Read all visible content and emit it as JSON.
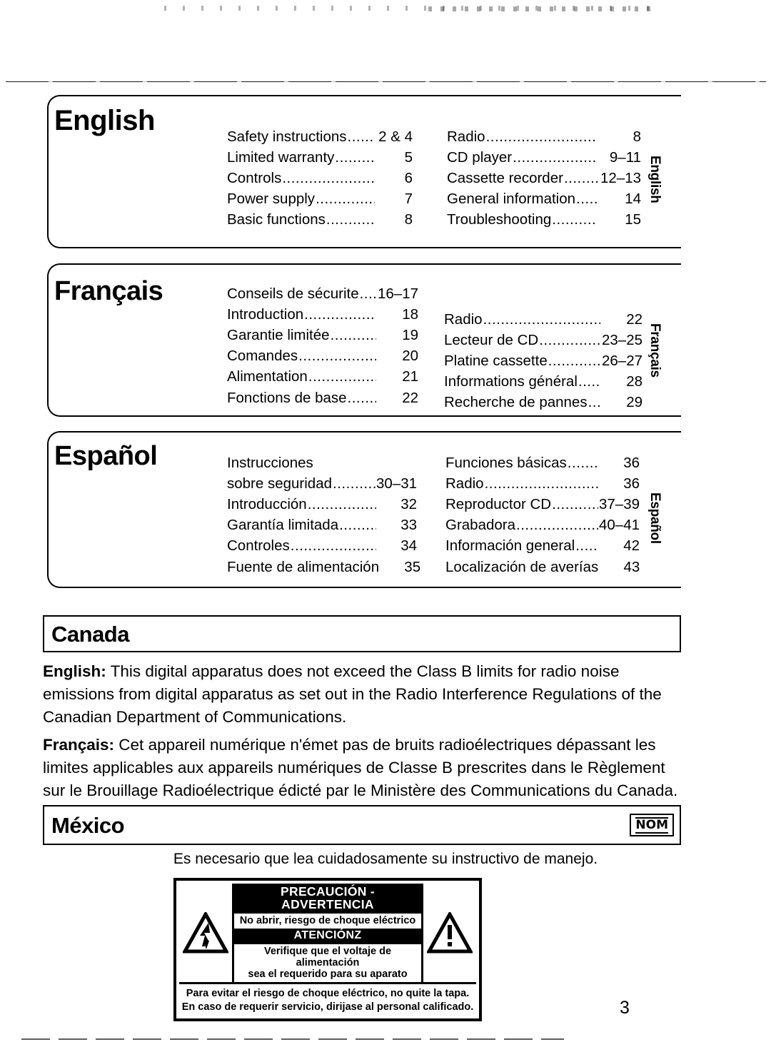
{
  "page": {
    "number": "3"
  },
  "sections": [
    {
      "id": "english",
      "title": "English",
      "side_tab": "English",
      "columns": [
        [
          {
            "label": "Safety instructions",
            "page": "2 & 4"
          },
          {
            "label": "Limited warranty",
            "page": "5"
          },
          {
            "label": "Controls",
            "page": "6"
          },
          {
            "label": "Power supply",
            "page": "7"
          },
          {
            "label": "Basic functions",
            "page": "8"
          }
        ],
        [
          {
            "label": "Radio",
            "page": "8"
          },
          {
            "label": "CD player",
            "page": "9–11"
          },
          {
            "label": "Cassette recorder",
            "page": "12–13"
          },
          {
            "label": "General information",
            "page": "14"
          },
          {
            "label": "Troubleshooting",
            "page": "15"
          }
        ]
      ]
    },
    {
      "id": "francais",
      "title": "Français",
      "side_tab": "Français",
      "columns": [
        [
          {
            "label": "Conseils de sécurite",
            "page": "16–17"
          },
          {
            "label": "Introduction",
            "page": "18"
          },
          {
            "label": "Garantie limitée",
            "page": "19"
          },
          {
            "label": "Comandes",
            "page": "20"
          },
          {
            "label": "Alimentation",
            "page": "21"
          },
          {
            "label": "Fonctions de base",
            "page": "22"
          }
        ],
        [
          {
            "label": "Radio",
            "page": "22"
          },
          {
            "label": "Lecteur de CD",
            "page": "23–25"
          },
          {
            "label": "Platine cassette",
            "page": "26–27"
          },
          {
            "label": "Informations général",
            "page": "28"
          },
          {
            "label": "Recherche de pannes",
            "page": "29"
          }
        ]
      ]
    },
    {
      "id": "espanol",
      "title": "Español",
      "side_tab": "Español",
      "columns": [
        [
          {
            "label": "Instrucciones",
            "page": "",
            "nodots": true
          },
          {
            "label": "sobre seguridad",
            "page": "30–31"
          },
          {
            "label": "Introducción",
            "page": "32"
          },
          {
            "label": "Garantía limitada",
            "page": "33"
          },
          {
            "label": "Controles",
            "page": "34"
          },
          {
            "label": "Fuente de alimentación",
            "page": "35"
          }
        ],
        [
          {
            "label": "Funciones básicas",
            "page": "36"
          },
          {
            "label": "Radio",
            "page": "36"
          },
          {
            "label": "Reproductor CD",
            "page": "37–39"
          },
          {
            "label": "Grabadora",
            "page": "40–41"
          },
          {
            "label": "Información general",
            "page": "42"
          },
          {
            "label": "Localización de averías",
            "page": "43"
          }
        ]
      ]
    }
  ],
  "canada": {
    "title": "Canada",
    "english_label": "English:",
    "english_text": " This digital apparatus does not exceed the Class B limits for radio noise emissions from digital apparatus as set out in the Radio Interference Regulations of the Canadian Department of Communications.",
    "francais_label": "Français:",
    "francais_text": " Cet appareil numérique n'émet pas de bruits radioélectriques dépassant les limites applicables aux appareils numériques de Classe B prescrites dans le Règlement sur le Brouillage Radioélectrique édicté par le Ministère des Communications du Canada."
  },
  "mexico": {
    "title": "México",
    "nom_badge": "NOM",
    "note": "Es necesario que lea cuidadosamente su instructivo de manejo.",
    "placard": {
      "heading": "PRECAUCIÓN - ADVERTENCIA",
      "subheading": "No abrir, riesgo de choque eléctrico",
      "heading2": "ATENCIÓNZ",
      "subheading2_line1": "Verifique que el voltaje de alimentación",
      "subheading2_line2": "sea el requerido para su aparato",
      "footer_line1": "Para evitar el riesgo de choque eléctrico, no quite la tapa.",
      "footer_line2": "En caso de requerir servicio, dirijase al personal calificado."
    }
  }
}
